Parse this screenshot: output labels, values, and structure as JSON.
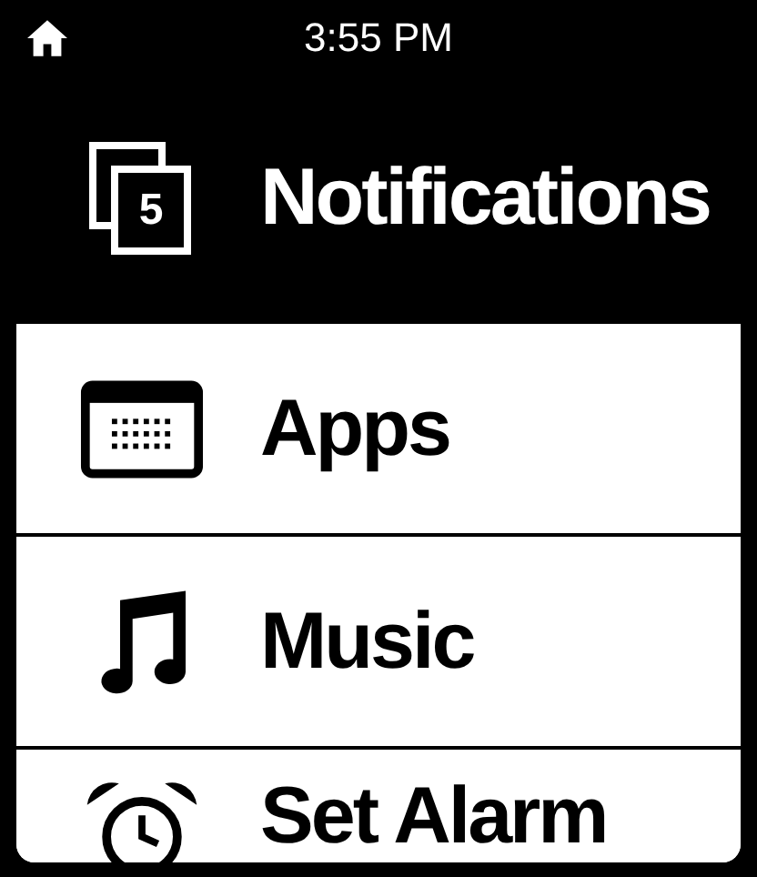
{
  "status_bar": {
    "time": "3:55 PM"
  },
  "menu_items": [
    {
      "kind": "notifications",
      "label": "Notifications",
      "badge": "5",
      "selected": true
    },
    {
      "kind": "apps",
      "label": "Apps",
      "selected": false
    },
    {
      "kind": "music",
      "label": "Music",
      "selected": false
    },
    {
      "kind": "alarm",
      "label": "Set Alarm",
      "selected": false
    }
  ]
}
